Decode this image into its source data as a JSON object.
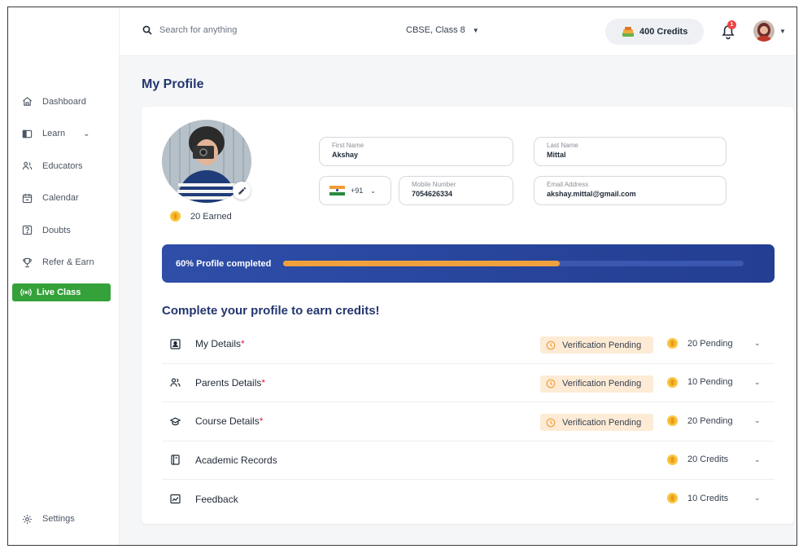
{
  "topbar": {
    "search_placeholder": "Search for anything",
    "board_label": "CBSE, Class 8",
    "credits_label": "400 Credits",
    "notification_count": "1"
  },
  "sidebar": {
    "items": [
      {
        "label": "Dashboard",
        "icon": "home-icon"
      },
      {
        "label": "Learn",
        "icon": "book-icon",
        "expandable": true
      },
      {
        "label": "Educators",
        "icon": "people-icon"
      },
      {
        "label": "Calendar",
        "icon": "calendar-icon"
      },
      {
        "label": "Doubts",
        "icon": "question-icon"
      },
      {
        "label": "Refer & Earn",
        "icon": "trophy-icon"
      }
    ],
    "live_class_label": "Live Class",
    "settings_label": "Settings"
  },
  "page": {
    "title": "My Profile"
  },
  "profile": {
    "earned_label": "20 Earned",
    "first_name": {
      "label": "First Name",
      "value": "Akshay"
    },
    "last_name": {
      "label": "Last Name",
      "value": "Mittal"
    },
    "country_code": "+91",
    "mobile": {
      "label": "Mobile Number",
      "value": "7054626334"
    },
    "email": {
      "label": "Email Address",
      "value": "akshay.mittal@gmail.com"
    }
  },
  "progress": {
    "label": "60% Profile completed",
    "fraction": 0.6
  },
  "sections": {
    "title": "Complete your profile to earn credits!",
    "items": [
      {
        "label": "My Details",
        "required": "*",
        "status": "Verification Pending",
        "credits": "20 Pending",
        "icon": "id-card-icon"
      },
      {
        "label": "Parents Details",
        "required": "*",
        "status": "Verification Pending",
        "credits": "10 Pending",
        "icon": "parents-icon"
      },
      {
        "label": "Course Details",
        "required": "*",
        "status": "Verification Pending",
        "credits": "20 Pending",
        "icon": "graduation-cap-icon"
      },
      {
        "label": "Academic Records",
        "required": "",
        "status": "",
        "credits": "20 Credits",
        "icon": "notebook-icon"
      },
      {
        "label": "Feedback",
        "required": "",
        "status": "",
        "credits": "10 Credits",
        "icon": "feedback-icon"
      }
    ]
  },
  "colors": {
    "primary_navy": "#23366f",
    "progress_bar": "#2e4ea8",
    "progress_fill": "#f0a13d",
    "live_green": "#35a13a",
    "pending_badge": "#fdebd5"
  }
}
